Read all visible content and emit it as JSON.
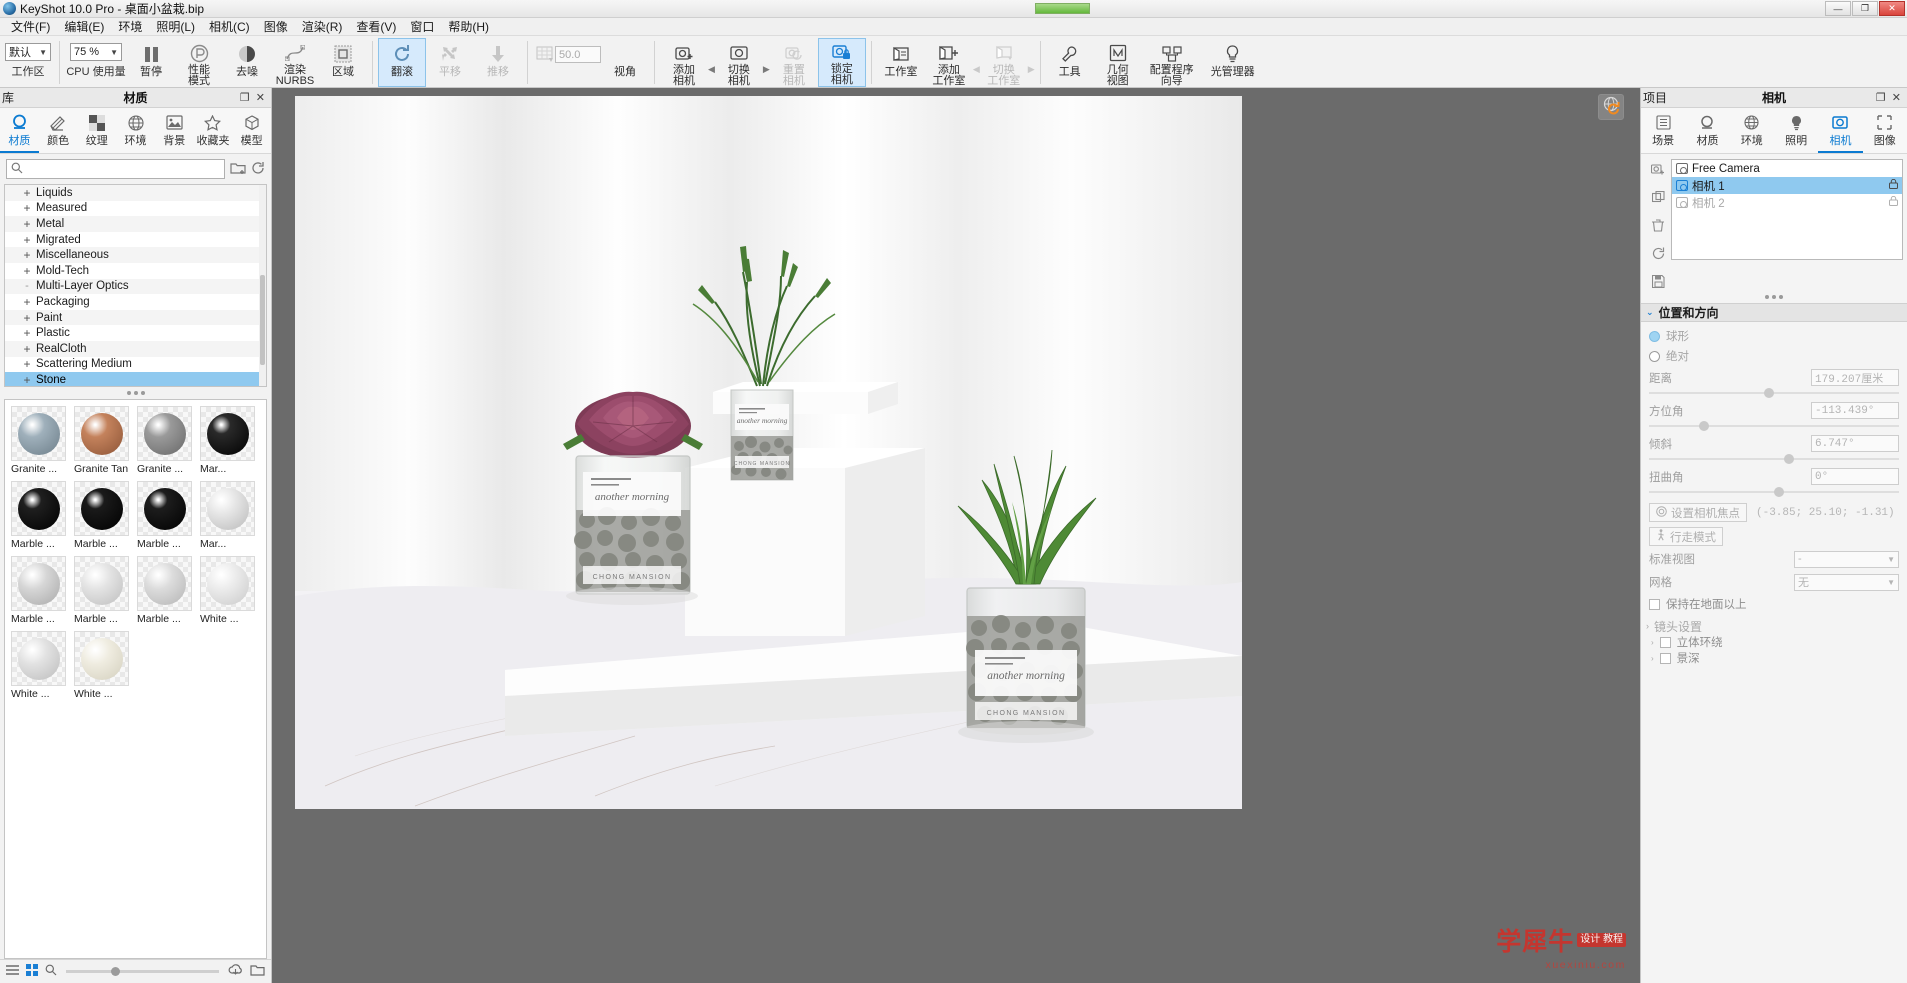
{
  "titlebar": {
    "app_title": "KeyShot 10.0 Pro  - 桌面小盆栽.bip",
    "icon": "keyshot-logo-icon",
    "minimize": "—",
    "maximize": "❐",
    "close": "✕"
  },
  "menubar": {
    "items": [
      {
        "label": "文件(F)"
      },
      {
        "label": "编辑(E)"
      },
      {
        "label": "环境"
      },
      {
        "label": "照明(L)"
      },
      {
        "label": "相机(C)"
      },
      {
        "label": "图像"
      },
      {
        "label": "渲染(R)"
      },
      {
        "label": "查看(V)"
      },
      {
        "label": "窗口"
      },
      {
        "label": "帮助(H)"
      }
    ]
  },
  "toolbar": {
    "workspace_value": "默认",
    "workspace_label": "工作区",
    "cpu_value": "75 %",
    "cpu_label": "CPU 使用量",
    "pause_label": "暂停",
    "performance_label": "性能\n模式",
    "denoise_label": "去噪",
    "nurbs_label": "渲染\nNURBS",
    "region_label": "区域",
    "rotate_label": "翻滚",
    "pan_label": "平移",
    "dolly_label": "推移",
    "fov_value": "50.0",
    "view_label": "视角",
    "add_camera_label": "添加\n相机",
    "switch_camera_label": "切换\n相机",
    "reset_camera_label": "重置\n相机",
    "lock_camera_label": "锁定\n相机",
    "studio_label": "工作室",
    "add_studio_label": "添加\n工作室",
    "switch_studio_label": "切换\n工作室",
    "tools_label": "工具",
    "geometry_view_label": "几何\n视图",
    "config_wizard_label": "配置程序\n向导",
    "light_manager_label": "光管理器",
    "left_arrow": "◀",
    "right_arrow": "▶"
  },
  "library": {
    "header_left": "库",
    "header_title": "材质",
    "header_float": "❐",
    "header_close": "✕",
    "tabs": [
      {
        "label": "材质",
        "icon": "material-ball-icon",
        "selected": true
      },
      {
        "label": "颜色",
        "icon": "color-swatches-icon",
        "selected": false
      },
      {
        "label": "纹理",
        "icon": "checker-texture-icon",
        "selected": false
      },
      {
        "label": "环境",
        "icon": "globe-icon",
        "selected": false
      },
      {
        "label": "背景",
        "icon": "picture-icon",
        "selected": false
      },
      {
        "label": "收藏夹",
        "icon": "star-icon",
        "selected": false
      },
      {
        "label": "模型",
        "icon": "cube-icon",
        "selected": false
      }
    ],
    "search_placeholder": "",
    "search_value": "",
    "search_icon": "search-icon",
    "import_icon": "folder-add-icon",
    "refresh_icon": "refresh-icon",
    "tree": [
      {
        "label": "Liquids",
        "expander": "+",
        "selected": false
      },
      {
        "label": "Measured",
        "expander": "+",
        "selected": false
      },
      {
        "label": "Metal",
        "expander": "+",
        "selected": false
      },
      {
        "label": "Migrated",
        "expander": "+",
        "selected": false
      },
      {
        "label": "Miscellaneous",
        "expander": "+",
        "selected": false
      },
      {
        "label": "Mold-Tech",
        "expander": "+",
        "selected": false
      },
      {
        "label": "Multi-Layer Optics",
        "expander": "-",
        "selected": false
      },
      {
        "label": "Packaging",
        "expander": "+",
        "selected": false
      },
      {
        "label": "Paint",
        "expander": "+",
        "selected": false
      },
      {
        "label": "Plastic",
        "expander": "+",
        "selected": false
      },
      {
        "label": "RealCloth",
        "expander": "+",
        "selected": false
      },
      {
        "label": "Scattering Medium",
        "expander": "+",
        "selected": false
      },
      {
        "label": "Stone",
        "expander": "+",
        "selected": true
      }
    ],
    "swatches": [
      {
        "label": "Granite ...",
        "color": "#9fb0bb"
      },
      {
        "label": "Granite Tan",
        "color": "#c4825c"
      },
      {
        "label": "Granite ...",
        "color": "#9a9a9a"
      },
      {
        "label": "Mar...",
        "color": "#1a1a1a"
      },
      {
        "label": "Marble ...",
        "color": "#121212"
      },
      {
        "label": "Marble ...",
        "color": "#0d0d0d"
      },
      {
        "label": "Marble ...",
        "color": "#101010"
      },
      {
        "label": "Mar...",
        "color": "#e2e2e2"
      },
      {
        "label": "Marble ...",
        "color": "#cfcfcf"
      },
      {
        "label": "Marble ...",
        "color": "#dcdcdc"
      },
      {
        "label": "Marble ...",
        "color": "#d4d4d4"
      },
      {
        "label": "White ...",
        "color": "#e8e8e8"
      },
      {
        "label": "White ...",
        "color": "#dedede"
      },
      {
        "label": "White ...",
        "color": "#efece0"
      }
    ],
    "footer": {
      "list_icon": "list-view-icon",
      "grid_icon": "grid-view-icon",
      "zoom_icon": "magnifier-icon",
      "cloud_icon": "cloud-download-icon",
      "folder_icon": "folder-icon"
    }
  },
  "viewport": {
    "env_rotate_icon": "environment-rotate-icon",
    "watermark_cn": "学犀牛",
    "watermark_badge": "设计\n教程",
    "watermark_sub": "xuexiniu.com"
  },
  "project": {
    "header_left": "项目",
    "header_title": "相机",
    "header_float": "❐",
    "header_close": "✕",
    "tabs": [
      {
        "label": "场景",
        "icon": "scene-tree-icon",
        "selected": false
      },
      {
        "label": "材质",
        "icon": "material-ball-icon",
        "selected": false
      },
      {
        "label": "环境",
        "icon": "globe-icon",
        "selected": false
      },
      {
        "label": "照明",
        "icon": "lightbulb-icon",
        "selected": false
      },
      {
        "label": "相机",
        "icon": "camera-icon",
        "selected": true
      },
      {
        "label": "图像",
        "icon": "image-frame-icon",
        "selected": false
      }
    ],
    "side_icons": [
      {
        "name": "add-camera-icon"
      },
      {
        "name": "copy-camera-icon"
      },
      {
        "name": "delete-camera-icon"
      },
      {
        "name": "reset-camera-icon"
      },
      {
        "name": "save-camera-icon"
      }
    ],
    "camera_list": [
      {
        "label": "Free Camera",
        "selected": false,
        "locked": false,
        "dim": false
      },
      {
        "label": "相机 1",
        "selected": true,
        "locked": true,
        "dim": false
      },
      {
        "label": "相机 2",
        "selected": false,
        "locked": true,
        "dim": true
      }
    ],
    "position_section": {
      "title": "位置和方向",
      "chevron": "⌄",
      "mode_spherical": "球形",
      "mode_absolute": "绝对",
      "fields": [
        {
          "label": "距离",
          "value": "179.207厘米",
          "knob_pct": 46
        },
        {
          "label": "方位角",
          "value": "-113.439°",
          "knob_pct": 20
        },
        {
          "label": "倾斜",
          "value": "6.747°",
          "knob_pct": 54
        },
        {
          "label": "扭曲角",
          "value": "0°",
          "knob_pct": 50
        }
      ],
      "set_focus_label": "设置相机焦点",
      "set_focus_icon": "target-icon",
      "focus_coords": "(-3.85; 25.10; -1.31)",
      "walk_mode_label": "行走模式",
      "walk_mode_icon": "walking-person-icon",
      "standard_view_label": "标准视图",
      "standard_view_value": "-",
      "grid_label": "网格",
      "grid_value": "无",
      "keep_above_ground_label": "保持在地面以上",
      "keep_above_ground_checked": false
    },
    "lens_section": {
      "title": "镜头设置",
      "chevron": "›",
      "items": [
        {
          "label": "立体环绕",
          "checked": false
        },
        {
          "label": "景深",
          "checked": false
        }
      ]
    }
  }
}
